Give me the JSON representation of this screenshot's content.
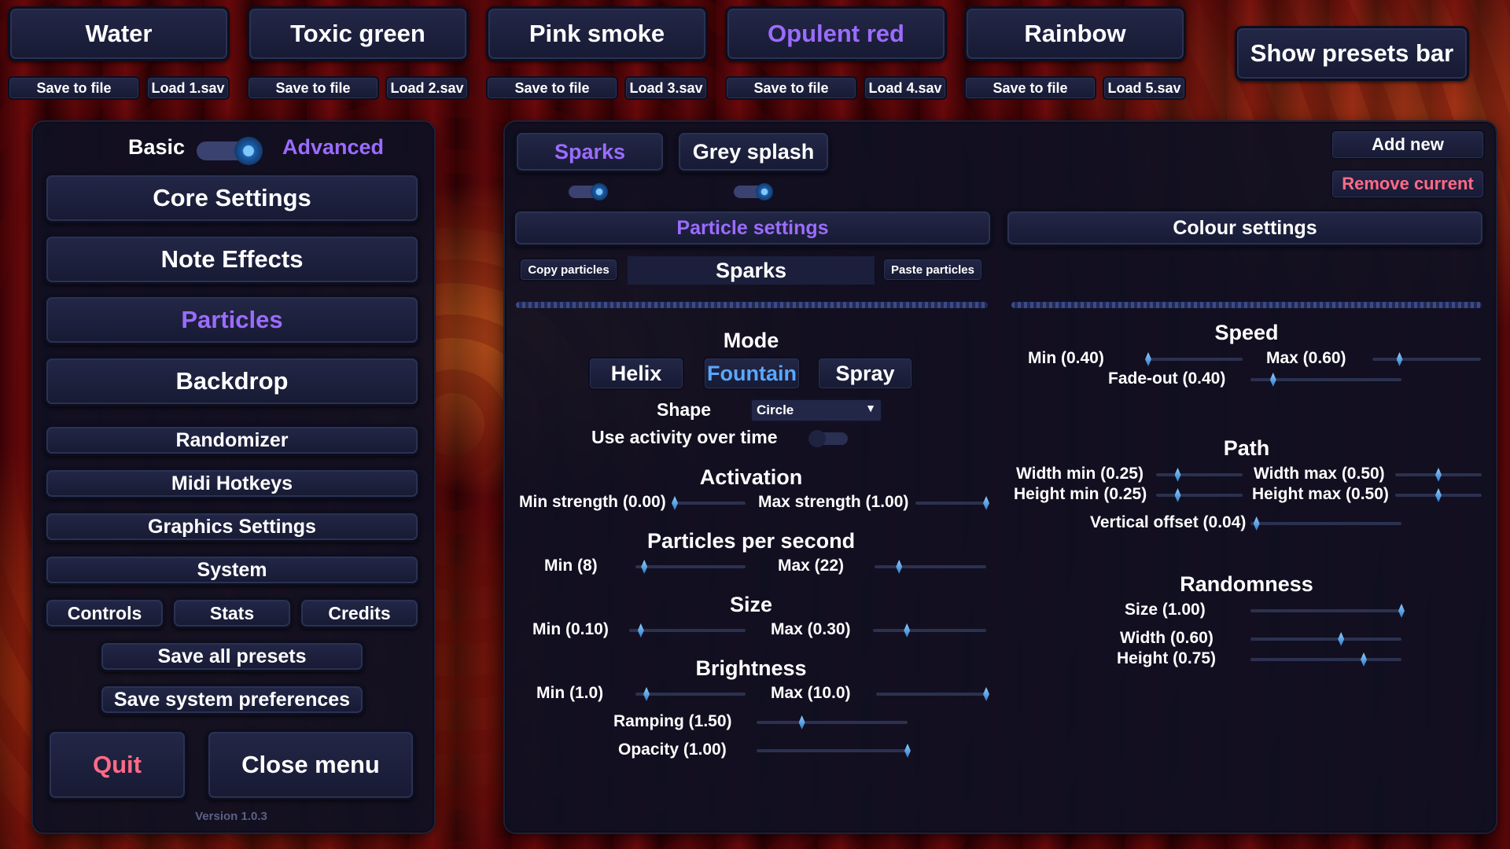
{
  "presets": [
    {
      "name": "Water",
      "save": "Save to file",
      "load": "Load 1.sav"
    },
    {
      "name": "Toxic green",
      "save": "Save to file",
      "load": "Load 2.sav"
    },
    {
      "name": "Pink smoke",
      "save": "Save to file",
      "load": "Load 3.sav"
    },
    {
      "name": "Opulent red",
      "save": "Save to file",
      "load": "Load 4.sav"
    },
    {
      "name": "Rainbow",
      "save": "Save to file",
      "load": "Load 5.sav"
    }
  ],
  "show_presets_bar": "Show presets bar",
  "menu": {
    "basic": "Basic",
    "advanced": "Advanced",
    "core": "Core Settings",
    "note": "Note Effects",
    "particles": "Particles",
    "backdrop": "Backdrop",
    "randomizer": "Randomizer",
    "midi": "Midi Hotkeys",
    "graphics": "Graphics Settings",
    "system": "System",
    "controls": "Controls",
    "stats": "Stats",
    "credits": "Credits",
    "save_all": "Save all presets",
    "save_sys": "Save system preferences",
    "quit": "Quit",
    "close": "Close menu",
    "version": "Version 1.0.3"
  },
  "main": {
    "tabs": [
      "Sparks",
      "Grey splash"
    ],
    "add_new": "Add new",
    "remove_current": "Remove current",
    "particle_settings": "Particle settings",
    "colour_settings": "Colour settings",
    "copy": "Copy particles",
    "current": "Sparks",
    "paste": "Paste particles",
    "mode_title": "Mode",
    "modes": [
      "Helix",
      "Fountain",
      "Spray"
    ],
    "shape_label": "Shape",
    "shape_value": "Circle",
    "activity_label": "Use activity over time",
    "activation_title": "Activation",
    "min_strength": "Min strength (0.00)",
    "max_strength": "Max strength (1.00)",
    "pps_title": "Particles per second",
    "pps_min": "Min (8)",
    "pps_max": "Max (22)",
    "size_title": "Size",
    "size_min": "Min (0.10)",
    "size_max": "Max (0.30)",
    "bright_title": "Brightness",
    "bright_min": "Min (1.0)",
    "bright_max": "Max (10.0)",
    "ramping": "Ramping (1.50)",
    "opacity": "Opacity (1.00)",
    "speed_title": "Speed",
    "speed_min": "Min (0.40)",
    "speed_max": "Max (0.60)",
    "fadeout": "Fade-out (0.40)",
    "path_title": "Path",
    "width_min": "Width min (0.25)",
    "width_max": "Width max (0.50)",
    "height_min": "Height min (0.25)",
    "height_max": "Height max (0.50)",
    "vertical_offset": "Vertical offset (0.04)",
    "rand_title": "Randomness",
    "rand_size": "Size (1.00)",
    "rand_width": "Width (0.60)",
    "rand_height": "Height (0.75)"
  },
  "slider_values": {
    "min_strength": 0.0,
    "max_strength": 1.0,
    "pps_min": 0.08,
    "pps_max": 0.22,
    "size_min": 0.1,
    "size_max": 0.3,
    "bright_min": 0.1,
    "bright_max": 1.0,
    "ramping": 0.3,
    "opacity": 1.0,
    "speed_min": 0.0,
    "speed_max": 0.25,
    "fadeout": 0.15,
    "width_min": 0.25,
    "width_max": 0.5,
    "height_min": 0.25,
    "height_max": 0.5,
    "vertical_offset": 0.04,
    "rand_size": 1.0,
    "rand_width": 0.6,
    "rand_height": 0.75
  },
  "colors": {
    "accent_purple": "#9b6cff",
    "accent_blue": "#5aa8ff",
    "accent_red": "#ff6b86",
    "panel": "#0e1022"
  }
}
